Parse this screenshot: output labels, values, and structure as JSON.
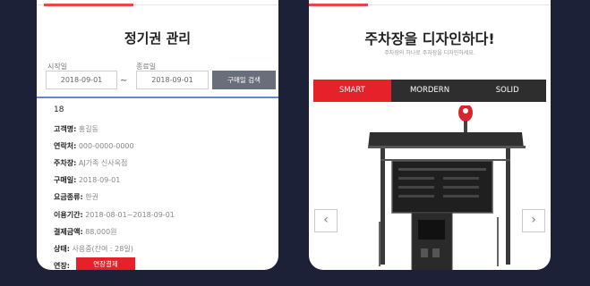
{
  "left_phone": {
    "title": "정기권 관리",
    "start_label": "시작일",
    "end_label": "종료일",
    "start_date": "2018-09-01",
    "end_date": "2018-09-01",
    "tilde": "~",
    "search_button": "구매일 검색",
    "count": "18",
    "rows": [
      {
        "key": "고객명:",
        "value": "홍길동"
      },
      {
        "key": "연락처:",
        "value": "000-0000-0000"
      },
      {
        "key": "주차장:",
        "value": "AJ가족 신사옥점"
      },
      {
        "key": "구매일:",
        "value": "2018-09-01"
      },
      {
        "key": "요금종류:",
        "value": "한권"
      },
      {
        "key": "이용기간:",
        "value": "2018-08-01~2018-09-01"
      },
      {
        "key": "결제금액:",
        "value": "88,000원"
      },
      {
        "key": "상태:",
        "value": "사용중(잔여 : 28일)"
      }
    ],
    "extend_label": "연장:",
    "extend_button": "연장결제"
  },
  "right_phone": {
    "title": "주차장을 디자인하다!",
    "subtitle": "주차장의 하나로 주차장을 디자인하세요.",
    "tabs": [
      {
        "label": "SMART",
        "active": true
      },
      {
        "label": "MORDERN",
        "active": false
      },
      {
        "label": "SOLID",
        "active": false
      }
    ],
    "prev_icon": "chevron-left-icon",
    "next_icon": "chevron-right-icon"
  },
  "colors": {
    "background": "#1c2138",
    "accent_red": "#e62129",
    "blue_divider": "#6b84c6",
    "tab_dark": "#2e2e2e",
    "search_button": "#686e7a"
  }
}
